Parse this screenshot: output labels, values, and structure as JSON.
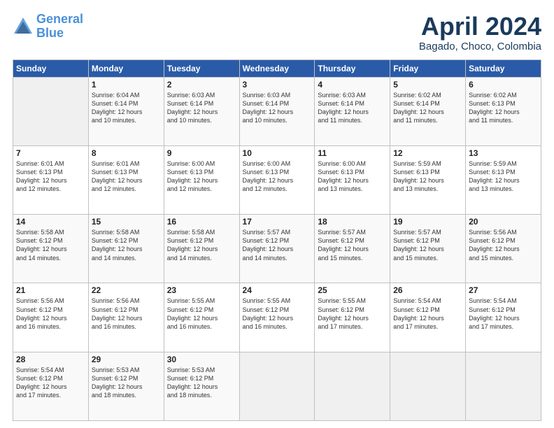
{
  "header": {
    "logo_line1": "General",
    "logo_line2": "Blue",
    "month": "April 2024",
    "location": "Bagado, Choco, Colombia"
  },
  "weekdays": [
    "Sunday",
    "Monday",
    "Tuesday",
    "Wednesday",
    "Thursday",
    "Friday",
    "Saturday"
  ],
  "weeks": [
    [
      {
        "day": "",
        "info": ""
      },
      {
        "day": "1",
        "info": "Sunrise: 6:04 AM\nSunset: 6:14 PM\nDaylight: 12 hours\nand 10 minutes."
      },
      {
        "day": "2",
        "info": "Sunrise: 6:03 AM\nSunset: 6:14 PM\nDaylight: 12 hours\nand 10 minutes."
      },
      {
        "day": "3",
        "info": "Sunrise: 6:03 AM\nSunset: 6:14 PM\nDaylight: 12 hours\nand 10 minutes."
      },
      {
        "day": "4",
        "info": "Sunrise: 6:03 AM\nSunset: 6:14 PM\nDaylight: 12 hours\nand 11 minutes."
      },
      {
        "day": "5",
        "info": "Sunrise: 6:02 AM\nSunset: 6:14 PM\nDaylight: 12 hours\nand 11 minutes."
      },
      {
        "day": "6",
        "info": "Sunrise: 6:02 AM\nSunset: 6:13 PM\nDaylight: 12 hours\nand 11 minutes."
      }
    ],
    [
      {
        "day": "7",
        "info": "Sunrise: 6:01 AM\nSunset: 6:13 PM\nDaylight: 12 hours\nand 12 minutes."
      },
      {
        "day": "8",
        "info": "Sunrise: 6:01 AM\nSunset: 6:13 PM\nDaylight: 12 hours\nand 12 minutes."
      },
      {
        "day": "9",
        "info": "Sunrise: 6:00 AM\nSunset: 6:13 PM\nDaylight: 12 hours\nand 12 minutes."
      },
      {
        "day": "10",
        "info": "Sunrise: 6:00 AM\nSunset: 6:13 PM\nDaylight: 12 hours\nand 12 minutes."
      },
      {
        "day": "11",
        "info": "Sunrise: 6:00 AM\nSunset: 6:13 PM\nDaylight: 12 hours\nand 13 minutes."
      },
      {
        "day": "12",
        "info": "Sunrise: 5:59 AM\nSunset: 6:13 PM\nDaylight: 12 hours\nand 13 minutes."
      },
      {
        "day": "13",
        "info": "Sunrise: 5:59 AM\nSunset: 6:13 PM\nDaylight: 12 hours\nand 13 minutes."
      }
    ],
    [
      {
        "day": "14",
        "info": "Sunrise: 5:58 AM\nSunset: 6:12 PM\nDaylight: 12 hours\nand 14 minutes."
      },
      {
        "day": "15",
        "info": "Sunrise: 5:58 AM\nSunset: 6:12 PM\nDaylight: 12 hours\nand 14 minutes."
      },
      {
        "day": "16",
        "info": "Sunrise: 5:58 AM\nSunset: 6:12 PM\nDaylight: 12 hours\nand 14 minutes."
      },
      {
        "day": "17",
        "info": "Sunrise: 5:57 AM\nSunset: 6:12 PM\nDaylight: 12 hours\nand 14 minutes."
      },
      {
        "day": "18",
        "info": "Sunrise: 5:57 AM\nSunset: 6:12 PM\nDaylight: 12 hours\nand 15 minutes."
      },
      {
        "day": "19",
        "info": "Sunrise: 5:57 AM\nSunset: 6:12 PM\nDaylight: 12 hours\nand 15 minutes."
      },
      {
        "day": "20",
        "info": "Sunrise: 5:56 AM\nSunset: 6:12 PM\nDaylight: 12 hours\nand 15 minutes."
      }
    ],
    [
      {
        "day": "21",
        "info": "Sunrise: 5:56 AM\nSunset: 6:12 PM\nDaylight: 12 hours\nand 16 minutes."
      },
      {
        "day": "22",
        "info": "Sunrise: 5:56 AM\nSunset: 6:12 PM\nDaylight: 12 hours\nand 16 minutes."
      },
      {
        "day": "23",
        "info": "Sunrise: 5:55 AM\nSunset: 6:12 PM\nDaylight: 12 hours\nand 16 minutes."
      },
      {
        "day": "24",
        "info": "Sunrise: 5:55 AM\nSunset: 6:12 PM\nDaylight: 12 hours\nand 16 minutes."
      },
      {
        "day": "25",
        "info": "Sunrise: 5:55 AM\nSunset: 6:12 PM\nDaylight: 12 hours\nand 17 minutes."
      },
      {
        "day": "26",
        "info": "Sunrise: 5:54 AM\nSunset: 6:12 PM\nDaylight: 12 hours\nand 17 minutes."
      },
      {
        "day": "27",
        "info": "Sunrise: 5:54 AM\nSunset: 6:12 PM\nDaylight: 12 hours\nand 17 minutes."
      }
    ],
    [
      {
        "day": "28",
        "info": "Sunrise: 5:54 AM\nSunset: 6:12 PM\nDaylight: 12 hours\nand 17 minutes."
      },
      {
        "day": "29",
        "info": "Sunrise: 5:53 AM\nSunset: 6:12 PM\nDaylight: 12 hours\nand 18 minutes."
      },
      {
        "day": "30",
        "info": "Sunrise: 5:53 AM\nSunset: 6:12 PM\nDaylight: 12 hours\nand 18 minutes."
      },
      {
        "day": "",
        "info": ""
      },
      {
        "day": "",
        "info": ""
      },
      {
        "day": "",
        "info": ""
      },
      {
        "day": "",
        "info": ""
      }
    ]
  ]
}
